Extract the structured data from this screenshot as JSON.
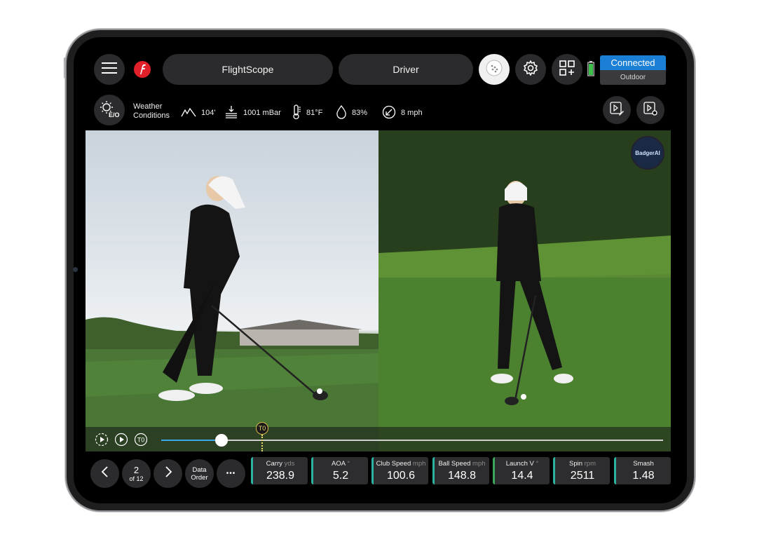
{
  "header": {
    "brand_name": "FlightScope",
    "club": "Driver",
    "connection_status": "Connected",
    "environment": "Outdoor",
    "icons": [
      "menu-icon",
      "flightscope-logo-icon",
      "golf-ball-icon",
      "settings-icon",
      "add-widget-icon",
      "battery-icon"
    ],
    "accent_color": "#1c7fd6"
  },
  "weather": {
    "toggle_label": "E/O",
    "label": "Weather Conditions",
    "altitude": "104'",
    "pressure": "1001 mBar",
    "temperature": "81°F",
    "humidity": "83%",
    "wind": "8 mph"
  },
  "video": {
    "overlay_logo": "BadgerAI",
    "t0_label": "T0",
    "progress": 0.12
  },
  "navigation": {
    "shot_number": "2",
    "shot_total": "of 12",
    "data_order_label": "Data Order",
    "more_label": "•••"
  },
  "metrics": [
    {
      "label": "Carry",
      "unit": "yds",
      "value": "238.9",
      "color": "#2bb3a0"
    },
    {
      "label": "AOA",
      "unit": "°",
      "value": "5.2",
      "color": "#2bb3a0"
    },
    {
      "label": "Club Speed",
      "unit": "mph",
      "value": "100.6",
      "color": "#2bb3a0"
    },
    {
      "label": "Ball Speed",
      "unit": "mph",
      "value": "148.8",
      "color": "#2bb3a0"
    },
    {
      "label": "Launch V",
      "unit": "°",
      "value": "14.4",
      "color": "#3ca55c"
    },
    {
      "label": "Spin",
      "unit": "rpm",
      "value": "2511",
      "color": "#2bb3a0"
    },
    {
      "label": "Smash",
      "unit": "",
      "value": "1.48",
      "color": "#2bb3a0"
    }
  ]
}
